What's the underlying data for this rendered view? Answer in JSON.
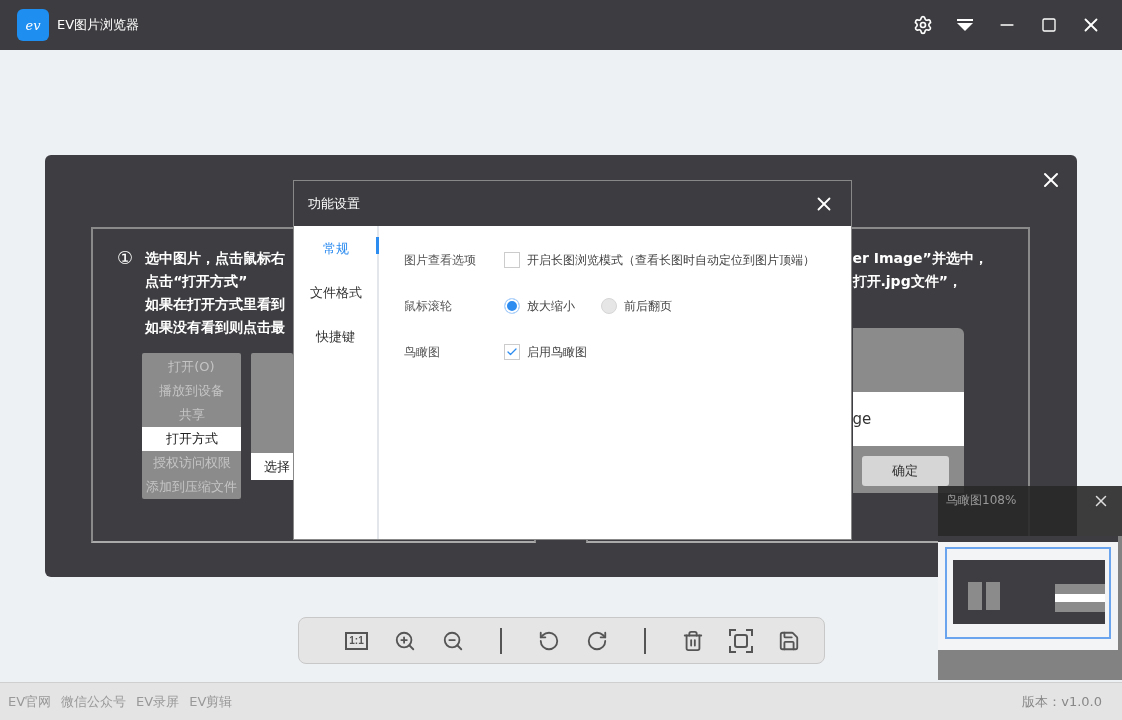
{
  "window": {
    "title": "EV图片浏览器",
    "logo_text": "ev"
  },
  "image": {
    "step": "①",
    "left_lines": [
      "选中图片，点击鼠标右",
      "点击“打开方式”",
      "如果在打开方式里看到",
      "如果没有看到则点击最"
    ],
    "context_menu": [
      {
        "label": "打开(O)",
        "selected": false
      },
      {
        "label": "播放到设备",
        "selected": false
      },
      {
        "label": "共享",
        "selected": false
      },
      {
        "label": "打开方式",
        "selected": true
      },
      {
        "label": "授权访问权限",
        "selected": false
      },
      {
        "label": "添加到压缩文件",
        "selected": false
      }
    ],
    "submenu": [
      {
        "label": "选择",
        "selected": true
      }
    ],
    "right_lines": [
      "er Image”并选中，",
      "打开.jpg文件”，"
    ],
    "dialog_preview": {
      "item": "ge",
      "button": "确定"
    }
  },
  "settings_dialog": {
    "title": "功能设置",
    "nav": [
      {
        "label": "常规",
        "selected": true
      },
      {
        "label": "文件格式",
        "selected": false
      },
      {
        "label": "快捷键",
        "selected": false
      }
    ],
    "options": [
      {
        "label": "图片查看选项",
        "controls": [
          {
            "kind": "checkbox",
            "label": "开启长图浏览模式（查看长图时自动定位到图片顶端）",
            "checked": false
          }
        ]
      },
      {
        "label": "鼠标滚轮",
        "controls": [
          {
            "kind": "radio",
            "label": "放大缩小",
            "selected": true
          },
          {
            "kind": "radio",
            "label": "前后翻页",
            "selected": false
          }
        ]
      },
      {
        "label": "鸟瞰图",
        "controls": [
          {
            "kind": "checkbox",
            "label": "启用鸟瞰图",
            "checked": true
          }
        ]
      }
    ]
  },
  "toolbar": {
    "actual_size_label": "1:1"
  },
  "birdseye": {
    "title": "鸟瞰图108%"
  },
  "footer": {
    "links": [
      "EV官网",
      "微信公众号",
      "EV录屏",
      "EV剪辑"
    ],
    "version": "版本：v1.0.0"
  }
}
